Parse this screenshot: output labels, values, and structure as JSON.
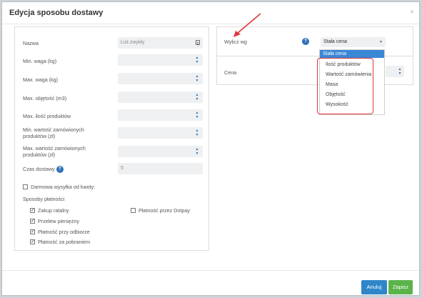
{
  "dialog": {
    "title": "Edycja sposobu dostawy",
    "close": "×"
  },
  "left": {
    "fields": [
      {
        "label": "Nazwa",
        "value": "List zwykły"
      },
      {
        "label": "Min. waga (kg)",
        "value": ""
      },
      {
        "label": "Max. waga (kg)",
        "value": ""
      },
      {
        "label": "Max. objętość (m3)",
        "value": ""
      },
      {
        "label": "Max. ilość produktów",
        "value": ""
      },
      {
        "label": "Min. wartość zamówionych produktów (zł)",
        "value": ""
      },
      {
        "label": "Max. wartość zamówionych produktów (zł)",
        "value": ""
      },
      {
        "label": "Czas dostawy",
        "value": "5"
      }
    ],
    "free_shipping_label": "Darmowa wysyłka od kwoty:",
    "payments_title": "Sposoby płatności",
    "payments": [
      {
        "label": "Zakup ratalny",
        "checked": true
      },
      {
        "label": "Przelew pieniężny",
        "checked": true
      },
      {
        "label": "Płatność przy odbiorze",
        "checked": true
      },
      {
        "label": "Płatność za pobraniem",
        "checked": true
      },
      {
        "label": "Płatność przez Dotpay",
        "checked": false
      }
    ],
    "help_icon": "?"
  },
  "right": {
    "calc_label": "Wylicz wg",
    "calc_value": "Stała cena",
    "price_label": "Cena",
    "help_icon": "?",
    "dropdown_options": [
      "Stała cena",
      "Ilość produktów",
      "Wartość zamówienia",
      "Masa",
      "Objętość",
      "Wysokość"
    ]
  },
  "footer": {
    "cancel_label": "Anuluj",
    "save_label": "Zapisz"
  },
  "colors": {
    "accent": "#2e6fb7",
    "highlight": "#e0353c",
    "save": "#5ab44a",
    "cancel": "#2e86c9"
  }
}
